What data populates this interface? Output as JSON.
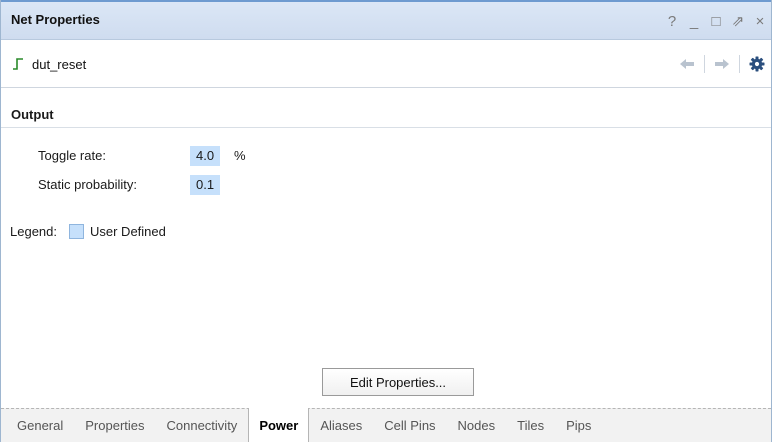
{
  "window": {
    "title": "Net Properties",
    "controls": [
      "?",
      "_",
      "□",
      "⇗",
      "×"
    ]
  },
  "toolbar": {
    "net_name": "dut_reset",
    "icons": [
      "back-arrow-icon",
      "forward-arrow-icon",
      "gear-icon"
    ]
  },
  "section": {
    "title": "Output"
  },
  "properties": {
    "toggle_rate": {
      "label": "Toggle rate:",
      "value": "4.0",
      "unit": "%"
    },
    "static_probability": {
      "label": "Static probability:",
      "value": "0.1"
    }
  },
  "legend": {
    "label": "Legend:",
    "item": "User Defined",
    "swatch_color": "#c6e0fb"
  },
  "buttons": {
    "edit_properties": "Edit Properties..."
  },
  "tabs": [
    {
      "label": "General",
      "active": false
    },
    {
      "label": "Properties",
      "active": false
    },
    {
      "label": "Connectivity",
      "active": false
    },
    {
      "label": "Power",
      "active": true
    },
    {
      "label": "Aliases",
      "active": false
    },
    {
      "label": "Cell Pins",
      "active": false
    },
    {
      "label": "Nodes",
      "active": false
    },
    {
      "label": "Tiles",
      "active": false
    },
    {
      "label": "Pips",
      "active": false
    }
  ],
  "colors": {
    "titlebar_accent": "#6e9bd0",
    "titlebar_bg": "#d5e2f3",
    "user_defined": "#c6e0fb",
    "net_icon": "#2a8a2a",
    "gear": "#2b4f7e"
  }
}
